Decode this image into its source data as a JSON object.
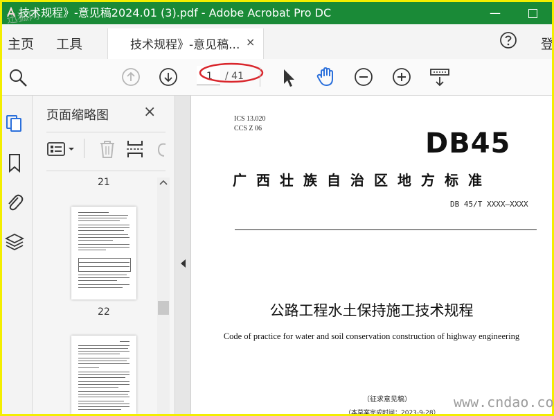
{
  "window": {
    "title": "技术规程》-意见稿2024.01 (3).pdf - Adobe Acrobat Pro DC",
    "watermark": "迅狐网",
    "min_label": "—"
  },
  "tabs": {
    "home": "主页",
    "tools": "工具",
    "document": "技术规程》-意见稿...",
    "close": "×",
    "login": "登"
  },
  "toolbar": {
    "current_page": "1",
    "total_pages": "/ 41"
  },
  "thumbnails": {
    "title": "页面缩略图",
    "close": "×",
    "page_numbers": [
      "21",
      "22"
    ]
  },
  "document": {
    "ics": "ICS  13.020",
    "ccs": "CCS  Z 06",
    "db": "DB45",
    "standard": "广西壮族自治区地方标准",
    "number": "DB 45/T  XXXX—XXXX",
    "title": "公路工程水土保持施工技术规程",
    "english_title": "Code of practice for water and soil conservation construction of highway engineering",
    "draft": "（征求意见稿）",
    "time": "（本草案完成时间：2023-9-28）"
  },
  "watermark_bottom": "www.cndao.com",
  "colors": {
    "titlebar": "#1a8a37",
    "accent_blue": "#2a6fdb",
    "highlight_red": "#d9262c"
  }
}
